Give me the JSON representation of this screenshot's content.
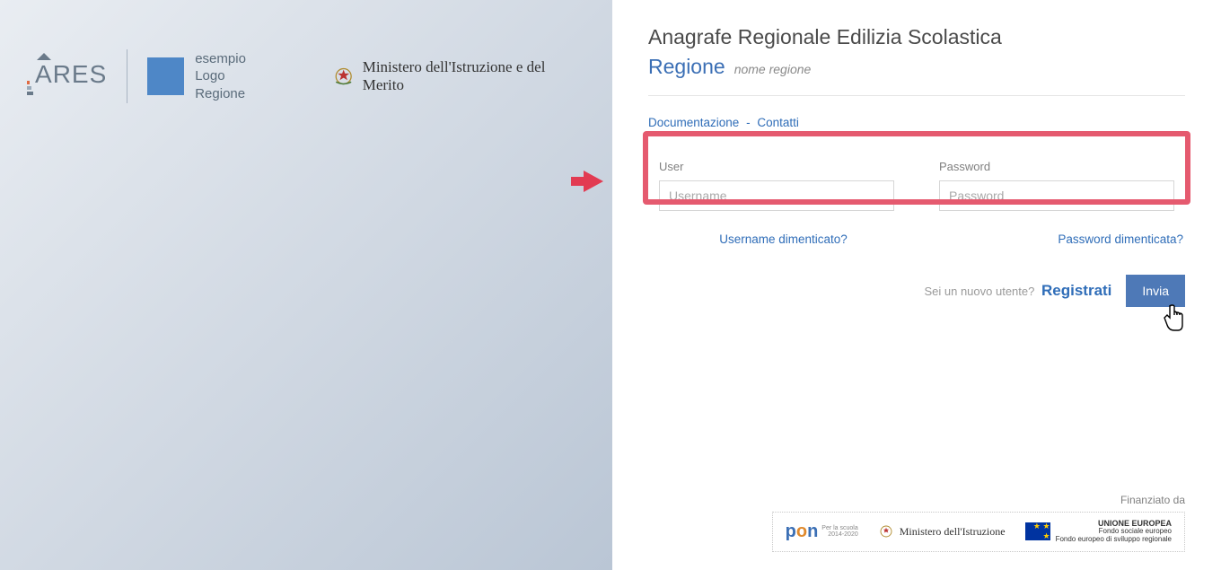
{
  "left": {
    "ares_text": "RES",
    "region_example_line1": "esempio",
    "region_example_line2": "Logo Regione",
    "ministero_label": "Ministero dell'Istruzione e del Merito"
  },
  "header": {
    "title": "Anagrafe Regionale Edilizia Scolastica",
    "subtitle_strong": "Regione",
    "subtitle_light": "nome regione"
  },
  "nav": {
    "doc": "Documentazione",
    "sep": "-",
    "contatti": "Contatti"
  },
  "form": {
    "user_label": "User",
    "user_placeholder": "Username",
    "pass_label": "Password",
    "pass_placeholder": "Password",
    "forgot_user": "Username dimenticato?",
    "forgot_pass": "Password dimenticata?",
    "new_user_prompt": "Sei un nuovo utente?",
    "register_label": "Registrati",
    "submit_label": "Invia"
  },
  "footer": {
    "financed_by": "Finanziato da",
    "pon_text": "pon",
    "pon_sub1": "Per la scuola",
    "pon_sub2": "2014-2020",
    "min_text": "Ministero dell'Istruzione",
    "eu_title": "UNIONE EUROPEA",
    "eu_sub": "Fondo sociale europeo\nFondo europeo di sviluppo regionale"
  }
}
